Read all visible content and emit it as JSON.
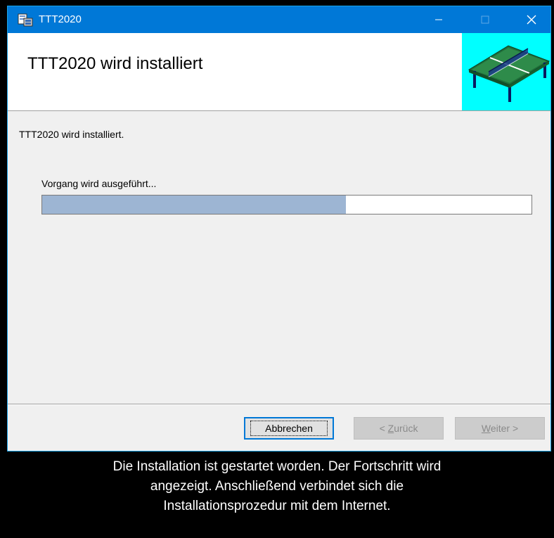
{
  "window": {
    "title": "TTT2020",
    "icon": "installer-icon",
    "controls": {
      "minimize": "minimize-icon",
      "maximize": "maximize-icon",
      "close": "close-icon"
    }
  },
  "banner": {
    "title": "TTT2020 wird installiert",
    "image": "table-tennis-table-icon",
    "image_background": "#00ffff"
  },
  "content": {
    "status_text": "TTT2020 wird installiert.",
    "progress_label": "Vorgang wird ausgeführt...",
    "progress_fraction": 0.62
  },
  "buttons": {
    "cancel": "Abbrechen",
    "back_prefix": "< ",
    "back_mnemonic": "Z",
    "back_rest": "urück",
    "next_mnemonic": "W",
    "next_rest": "eiter >"
  },
  "caption": {
    "line1": "Die Installation ist gestartet worden. Der Fortschritt wird",
    "line2": "angezeigt. Anschließend verbindet sich die",
    "line3": "Installationsprozedur mit dem Internet."
  },
  "colors": {
    "titlebar": "#0078d7",
    "progress": "#9db5d3",
    "caption_background": "#000000"
  }
}
